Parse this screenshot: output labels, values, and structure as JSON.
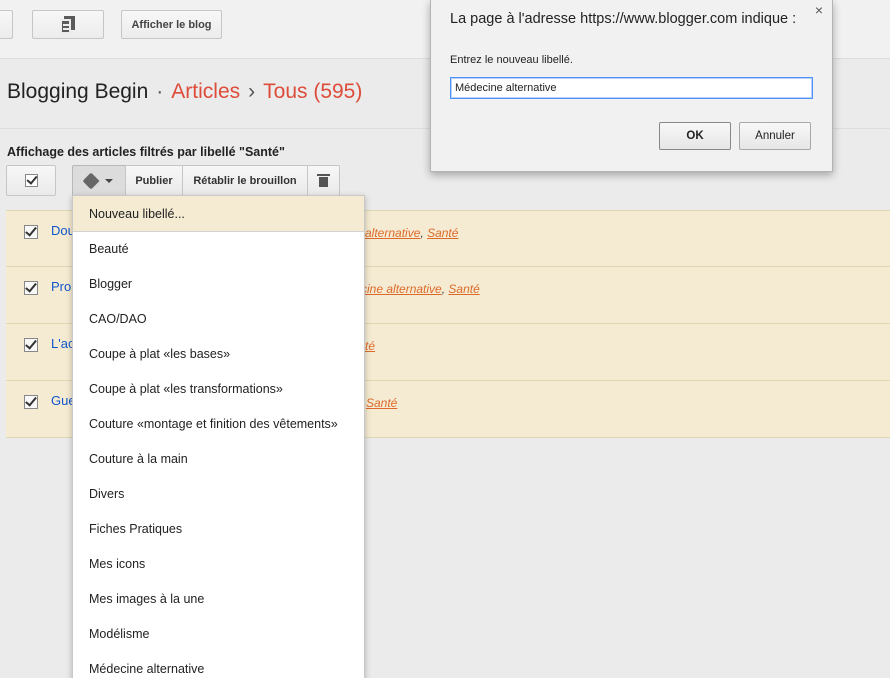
{
  "toolbar": {
    "view_blog_label": "Afficher le blog"
  },
  "header": {
    "blog_name": "Blogging Begin",
    "separator": "·",
    "section": "Articles",
    "arrow": "›",
    "filter": "Tous (595)"
  },
  "filter_text": "Affichage des articles filtrés par libellé \"Santé\"",
  "actions": {
    "publish": "Publier",
    "revert": "Rétablir le brouillon"
  },
  "posts": [
    {
      "title": "Dou",
      "tags": [
        {
          "text": "alternative",
          "sep": ","
        },
        {
          "text": "Santé",
          "sep": ""
        }
      ]
    },
    {
      "title": "Pro",
      "tags": [
        {
          "text": "cine alternative",
          "sep": ","
        },
        {
          "text": "Santé",
          "sep": ""
        }
      ]
    },
    {
      "title": "L'ac",
      "tags": [
        {
          "text": "té",
          "sep": ""
        }
      ]
    },
    {
      "title": "Gue",
      "tags": [
        {
          "text": "Santé",
          "sep": ""
        }
      ]
    }
  ],
  "label_menu": {
    "new_label": "Nouveau libellé...",
    "items": [
      "Beauté",
      "Blogger",
      "CAO/DAO",
      "Coupe à plat «les bases»",
      "Coupe à plat «les transformations»",
      "Couture «montage et finition des vêtements»",
      "Couture à la main",
      "Divers",
      "Fiches Pratiques",
      "Mes icons",
      "Mes images à la une",
      "Modélisme",
      "Médecine alternative"
    ]
  },
  "dialog": {
    "title": "La page à l'adresse https://www.blogger.com indique :",
    "close": "×",
    "prompt": "Entrez le nouveau libellé.",
    "input_value": "Médecine alternative",
    "ok": "OK",
    "cancel": "Annuler"
  },
  "colors": {
    "accent": "#dd4b39",
    "link": "#1155cc",
    "row_highlight": "#f4ebd2"
  }
}
